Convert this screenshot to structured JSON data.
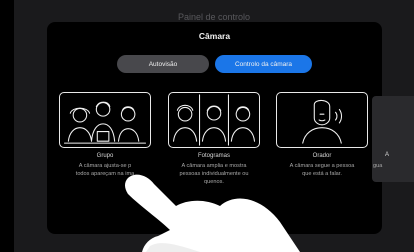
{
  "panel": {
    "title": "Painel de controlo"
  },
  "dialog": {
    "title": "Câmara",
    "tabs": [
      {
        "label": "Autovisão",
        "active": false
      },
      {
        "label": "Controlo da câmara",
        "active": true
      }
    ],
    "cards": [
      {
        "title": "Grupo",
        "desc_lines": [
          "A câmara ajusta-se p",
          "todos apareçam na ima"
        ]
      },
      {
        "title": "Fotogramas",
        "desc_lines": [
          "A câmara amplia e mostra",
          "pessoas individualmente ou",
          "quenos."
        ]
      },
      {
        "title": "Orador",
        "desc_lines": [
          "A câmara segue a pessoa",
          "que está a falar."
        ]
      }
    ],
    "partial_card": {
      "title": "A",
      "desc": "gua"
    }
  },
  "colors": {
    "accent": "#1b76e8",
    "background": "#000000",
    "panel": "#1a1a1c"
  }
}
